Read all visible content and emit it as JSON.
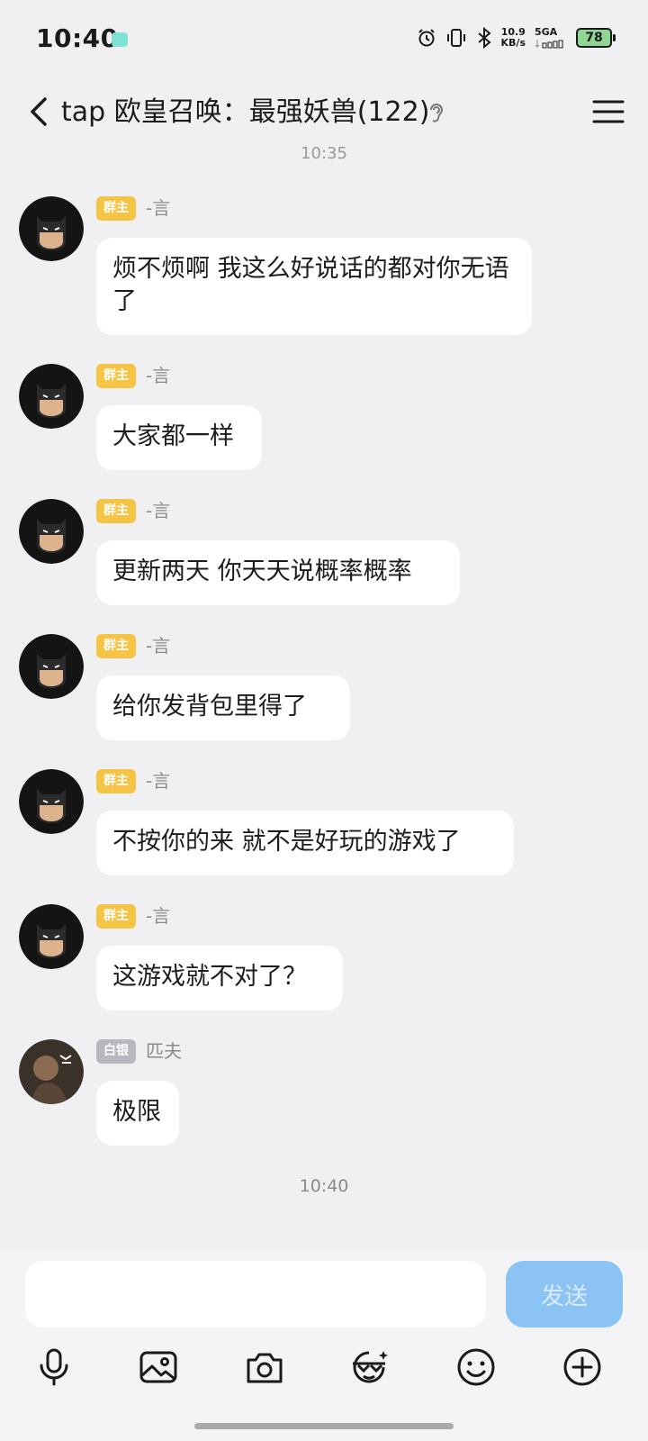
{
  "status_bar": {
    "time": "10:40",
    "net_speed_value": "10.9",
    "net_speed_unit": "KB/s",
    "signal_label": "5GA",
    "battery_level": "78"
  },
  "header": {
    "title": "tap 欧皇召唤：最强妖兽(122)"
  },
  "timestamps": {
    "top": "10:35",
    "bottom": "10:40"
  },
  "messages": [
    {
      "badge": "群主",
      "sender": "-言",
      "text": "烦不烦啊 我这么好说话的都对你无语了"
    },
    {
      "badge": "群主",
      "sender": "-言",
      "text": "大家都一样"
    },
    {
      "badge": "群主",
      "sender": "-言",
      "text": "更新两天 你天天说概率概率"
    },
    {
      "badge": "群主",
      "sender": "-言",
      "text": "给你发背包里得了"
    },
    {
      "badge": "群主",
      "sender": "-言",
      "text": "不按你的来 就不是好玩的游戏了"
    },
    {
      "badge": "群主",
      "sender": "-言",
      "text": "这游戏就不对了？"
    },
    {
      "badge": "白银",
      "sender": "匹夫",
      "text": "极限"
    }
  ],
  "input": {
    "value": "",
    "send_label": "发送"
  },
  "toolbar": [
    "microphone-icon",
    "image-icon",
    "camera-icon",
    "sticker-icon",
    "emoji-icon",
    "plus-icon"
  ],
  "colors": {
    "background": "#f0f0f2",
    "owner_badge": "#f6c445",
    "silver_badge": "#b7b7bd",
    "send_button": "#8cc3f5"
  }
}
